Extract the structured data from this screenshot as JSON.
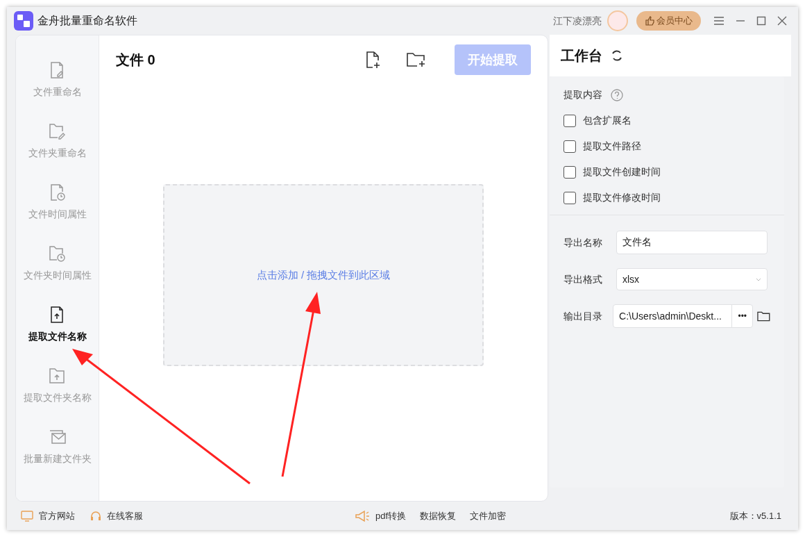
{
  "window": {
    "title": "金舟批量重命名软件",
    "user": "江下凌漂亮",
    "vip_button": "会员中心"
  },
  "sidebar": {
    "items": [
      {
        "label": "文件重命名",
        "selected": false
      },
      {
        "label": "文件夹重命名",
        "selected": false
      },
      {
        "label": "文件时间属性",
        "selected": false
      },
      {
        "label": "文件夹时间属性",
        "selected": false
      },
      {
        "label": "提取文件名称",
        "selected": true
      },
      {
        "label": "提取文件夹名称",
        "selected": false
      },
      {
        "label": "批量新建文件夹",
        "selected": false
      }
    ]
  },
  "main": {
    "title": "文件 0",
    "start_button": "开始提取",
    "start_disabled": true,
    "drop_hint": "点击添加 / 拖拽文件到此区域"
  },
  "workbench": {
    "title": "工作台",
    "section_label": "提取内容",
    "options": [
      {
        "label": "包含扩展名",
        "checked": false
      },
      {
        "label": "提取文件路径",
        "checked": false
      },
      {
        "label": "提取文件创建时间",
        "checked": false
      },
      {
        "label": "提取文件修改时间",
        "checked": false
      }
    ],
    "export_name_label": "导出名称",
    "export_name": "文件名",
    "export_format_label": "导出格式",
    "export_format": "xlsx",
    "output_dir_label": "输出目录",
    "output_dir": "C:\\Users\\admin\\Deskt...",
    "browse_button": "•••"
  },
  "status_bar": {
    "left": [
      "官方网站",
      "在线客服"
    ],
    "center": [
      "pdf转换",
      "数据恢复",
      "文件加密"
    ],
    "version": "版本：v5.1.1"
  }
}
